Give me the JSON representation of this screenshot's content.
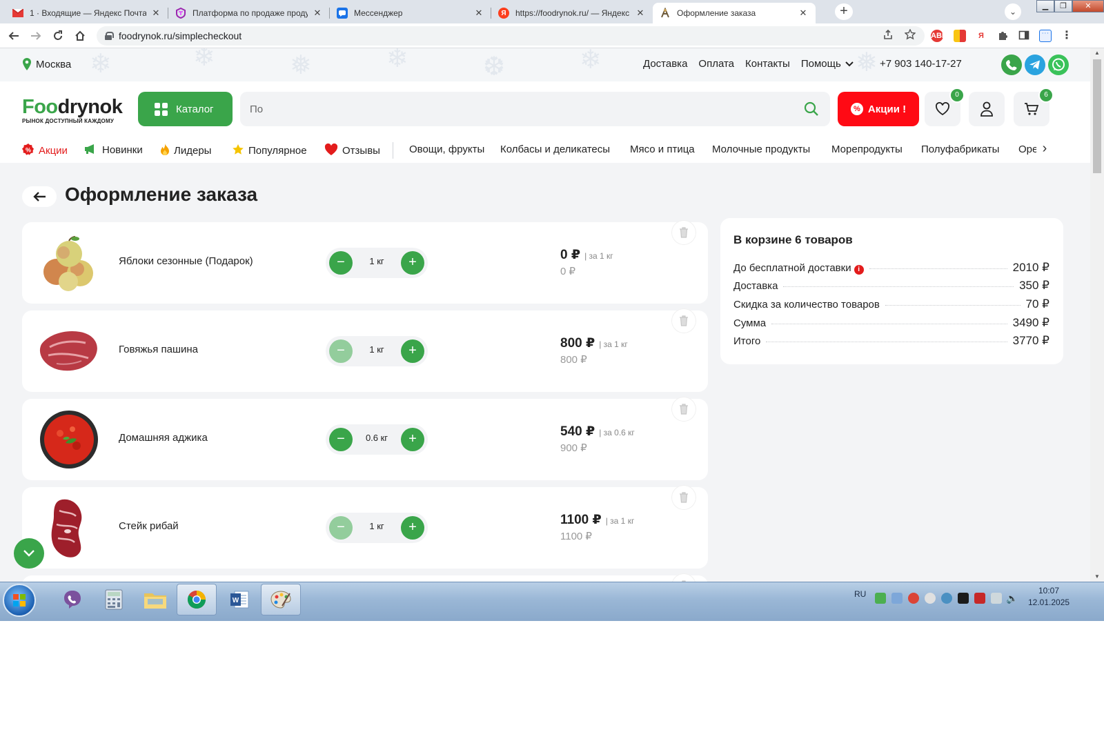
{
  "browser": {
    "tabs": [
      {
        "title": "1 · Входящие — Яндекс Почта",
        "icon": "mail-icon",
        "color": "#e53935"
      },
      {
        "title": "Платформа по продаже продуктов",
        "icon": "platform-icon",
        "color": "#9c27b0"
      },
      {
        "title": "Мессенджер",
        "icon": "messenger-icon",
        "color": "#1a73e8"
      },
      {
        "title": "https://foodrynok.ru/ — Яндекс",
        "icon": "yandex-icon",
        "color": "#fc3f1d"
      },
      {
        "title": "Оформление заказа",
        "icon": "foodrynok-favicon-icon",
        "color": "#8a6d3b"
      }
    ],
    "close_glyph": "✕",
    "new_tab": "+",
    "url": "foodrynok.ru/simplecheckout",
    "ext_badge": "4"
  },
  "site": {
    "city": "Москва",
    "top_links": [
      "Доставка",
      "Оплата",
      "Контакты"
    ],
    "help_label": "Помощь",
    "phone": "+7 903 140-17-27",
    "logo": {
      "part1": "F",
      "part2": "oo",
      "part3": "drynok",
      "tagline": "РЫНОК ДОСТУПНЫЙ КАЖДОМУ"
    },
    "catalog_label": "Каталог",
    "search_value": "По",
    "promo_label": "Акции !",
    "favorites_count": "0",
    "cart_count": "6",
    "categories": [
      {
        "label": "Акции",
        "icon": "promo-icon",
        "color": "#e31c1c"
      },
      {
        "label": "Новинки",
        "icon": "megaphone-icon",
        "color": "#222"
      },
      {
        "label": "Лидеры",
        "icon": "flame-icon",
        "color": "#222"
      },
      {
        "label": "Популярное",
        "icon": "star-icon",
        "color": "#222"
      },
      {
        "label": "Отзывы",
        "icon": "heart-icon",
        "color": "#222"
      },
      {
        "label": "Овощи, фрукты"
      },
      {
        "label": "Колбасы и деликатесы"
      },
      {
        "label": "Мясо и птица"
      },
      {
        "label": "Молочные продукты"
      },
      {
        "label": "Морепродукты"
      },
      {
        "label": "Полуфабрикаты"
      },
      {
        "label": "Орехи"
      }
    ],
    "accent": "#3aa54a",
    "promo_color": "#ff0a14"
  },
  "checkout": {
    "title": "Оформление заказа",
    "items": [
      {
        "name": "Яблоки сезонные (Подарок)",
        "qty": "1 кг",
        "price": "0 ₽",
        "per": "| за 1 кг",
        "unit_price": "0 ₽",
        "minus_enabled": true,
        "image": "apples-image"
      },
      {
        "name": "Говяжья пашина",
        "qty": "1 кг",
        "price": "800 ₽",
        "per": "| за 1 кг",
        "unit_price": "800 ₽",
        "minus_enabled": false,
        "image": "beef-image"
      },
      {
        "name": "Домашняя аджика",
        "qty": "0.6 кг",
        "price": "540 ₽",
        "per": "| за 0.6 кг",
        "unit_price": "900 ₽",
        "minus_enabled": true,
        "image": "adjika-image"
      },
      {
        "name": "Стейк рибай",
        "qty": "1 кг",
        "price": "1100 ₽",
        "per": "| за 1 кг",
        "unit_price": "1100 ₽",
        "minus_enabled": false,
        "image": "ribeye-image"
      }
    ],
    "summary": {
      "title": "В корзине 6 товаров",
      "rows": [
        {
          "label": "До бесплатной доставки",
          "value": "2010 ₽",
          "info": "i"
        },
        {
          "label": "Доставка",
          "value": "350 ₽"
        },
        {
          "label": "Скидка за количество товаров",
          "value": "70 ₽"
        },
        {
          "label": "Сумма",
          "value": "3490 ₽"
        },
        {
          "label": "Итого",
          "value": "3770 ₽"
        }
      ]
    }
  },
  "taskbar": {
    "lang": "RU",
    "time": "10:07",
    "date": "12.01.2025"
  }
}
